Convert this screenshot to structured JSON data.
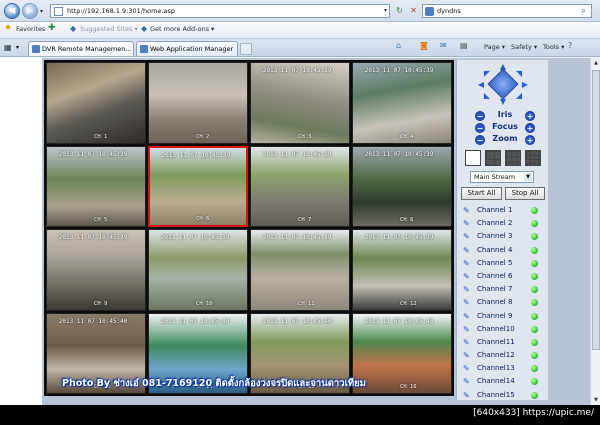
{
  "browser": {
    "url": "http://192.168.1.9:301/home.asp",
    "search_value": "dyndns",
    "favorites_label": "Favorites",
    "suggested_label": "Suggested Sites ▾",
    "addons_label": "Get more Add-ons ▾",
    "tabs": [
      {
        "label": "DVR Remote Managemen..."
      },
      {
        "label": "Web Application Manager"
      }
    ],
    "commands": {
      "page": "Page ▾",
      "safety": "Safety ▾",
      "tools": "Tools ▾"
    }
  },
  "cameras": [
    {
      "timestamp": "",
      "channel": "CH 1",
      "scene": "scene-a"
    },
    {
      "timestamp": "",
      "channel": "CH 2",
      "scene": "scene-b"
    },
    {
      "timestamp": "2013 11 07 10:45:39",
      "channel": "CH 3",
      "scene": "scene-c"
    },
    {
      "timestamp": "2013 11 07 10:45:39",
      "channel": "CH 4",
      "scene": "scene-d"
    },
    {
      "timestamp": "2013 11 07 10:45:39",
      "channel": "CH 5",
      "scene": "scene-e"
    },
    {
      "timestamp": "2013 11 07 10:45:39",
      "channel": "CH 6",
      "scene": "scene-f",
      "selected": true
    },
    {
      "timestamp": "2013 11 07 10:45:39",
      "channel": "CH 7",
      "scene": "scene-g"
    },
    {
      "timestamp": "2013 11 07 10:45:39",
      "channel": "CH 8",
      "scene": "scene-h"
    },
    {
      "timestamp": "2013 11 07 10:45:39",
      "channel": "CH 9",
      "scene": "scene-i"
    },
    {
      "timestamp": "2013 11 07 10:45:39",
      "channel": "CH 10",
      "scene": "scene-j"
    },
    {
      "timestamp": "2013 11 07 10:45:39",
      "channel": "CH 11",
      "scene": "scene-k"
    },
    {
      "timestamp": "2013 11 07 10:45:39",
      "channel": "CH 12",
      "scene": "scene-l"
    },
    {
      "timestamp": "2013 11 07 10:45:40",
      "channel": "CH 13",
      "scene": "scene-m"
    },
    {
      "timestamp": "2013 11 07 10:45:40",
      "channel": "CH 14",
      "scene": "scene-n"
    },
    {
      "timestamp": "2013 11 07 10:45:40",
      "channel": "CH 15",
      "scene": "scene-o"
    },
    {
      "timestamp": "2013 11 07 10:45:40",
      "channel": "CH 16",
      "scene": "scene-p"
    }
  ],
  "watermark": "Photo By ช่างเอ๋ 081-7169120 ติดตั้งกล้องวงจรปิดและจานดาวเทียม",
  "ptz": {
    "iris": "Iris",
    "focus": "Focus",
    "zoom": "Zoom",
    "minus": "−",
    "plus": "+"
  },
  "stream": {
    "selected": "Main Stream"
  },
  "buttons": {
    "start_all": "Start All",
    "stop_all": "Stop All"
  },
  "channels": [
    "Channel 1",
    "Channel 2",
    "Channel 3",
    "Channel 4",
    "Channel 5",
    "Channel 6",
    "Channel 7",
    "Channel 8",
    "Channel 9",
    "Channel10",
    "Channel11",
    "Channel12",
    "Channel13",
    "Channel14",
    "Channel15"
  ],
  "site_credit": "[640x433] https://upic.me/",
  "colors": {
    "accent": "#2a55c4",
    "selected_border": "#dd1111",
    "status_online": "#2fb52f"
  }
}
